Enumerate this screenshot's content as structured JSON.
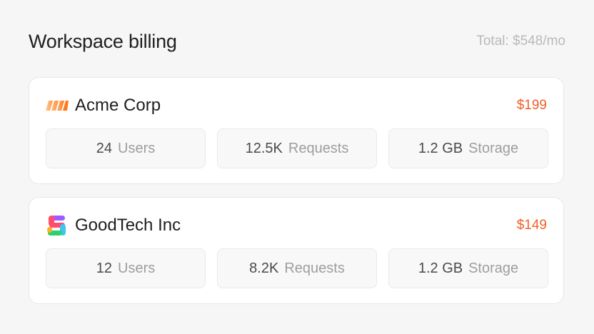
{
  "header": {
    "title": "Workspace billing",
    "total": "Total: $548/mo"
  },
  "orgs": [
    {
      "name": "Acme Corp",
      "price": "$199",
      "logo_icon": "acme-stripes-logo",
      "stats": [
        {
          "value": "24",
          "label": "Users"
        },
        {
          "value": "12.5K",
          "label": "Requests"
        },
        {
          "value": "1.2 GB",
          "label": "Storage"
        }
      ]
    },
    {
      "name": "GoodTech Inc",
      "price": "$149",
      "logo_icon": "goodtech-s-logo",
      "stats": [
        {
          "value": "12",
          "label": "Users"
        },
        {
          "value": "8.2K",
          "label": "Requests"
        },
        {
          "value": "1.2 GB",
          "label": "Storage"
        }
      ]
    }
  ],
  "colors": {
    "accent_price": "#f0602a",
    "background": "#f6f6f6",
    "card": "#ffffff"
  }
}
